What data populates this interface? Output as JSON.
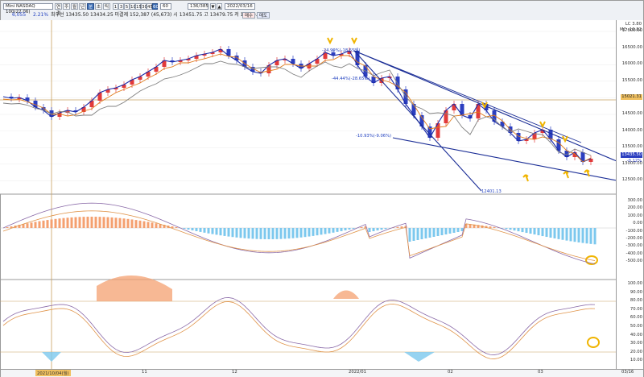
{
  "toolbar": {
    "symbol": "Mini NASDAQ 100(22.06)",
    "tab_labels": [
      "연결",
      "주",
      "월",
      "년",
      "분",
      "초",
      "틱"
    ],
    "interval_buttons": [
      "1",
      "3",
      "5",
      "10",
      "15",
      "30",
      "45",
      "60"
    ],
    "interval_input": "60",
    "count_input": "136/385",
    "date_input": "2022/03/16",
    "row1_extra": [
      "▼",
      "▲"
    ],
    "change_value": "6,055",
    "change_pct": "2.21%",
    "price_line": "최우선 13435.50  13434.25 미결제  152,387 (45,673) 시 13451.75 고 13479.75 저 13420.50",
    "order_button": "매수",
    "sell_button": "매도"
  },
  "price_axis": {
    "labels": [
      "17000.00",
      "16500.00",
      "16000.00",
      "15500.00",
      "15000.00",
      "14500.00",
      "14000.00",
      "13500.00",
      "13000.00",
      "12500.00"
    ],
    "top_labels": [
      "LC 3.80",
      "MC -10.82"
    ],
    "hline_tag": "15021.31",
    "last_price_tag": "13435.50",
    "last_change_tag": "-0.12%"
  },
  "macd_axis": {
    "labels": [
      "300.00",
      "200.00",
      "100.00",
      "0.00",
      "-100.00",
      "-200.00",
      "-300.00",
      "-400.00",
      "-500.00"
    ]
  },
  "stoch_axis": {
    "labels": [
      "100.00",
      "90.00",
      "80.00",
      "70.00",
      "60.00",
      "50.00",
      "40.00",
      "30.00",
      "20.00",
      "10.00"
    ]
  },
  "x_axis": {
    "cursor_date": "2021/10/04(월)",
    "labels": [
      "11",
      "12",
      "2022/01",
      "02",
      "03",
      "03/16"
    ]
  },
  "annotations": {
    "high_label": "-24.99%(-18.55%)",
    "mid_label": "-44.44%(-28.65%)",
    "low_channel_label": "-10.93%(-9.06%)",
    "bottom_label": "12401.13"
  },
  "colors": {
    "up": "#e23a3a",
    "down": "#2c3fc0",
    "ma_fast": "#1a2aa8",
    "ma_mid": "#e07a1a",
    "ma_slow": "#808080",
    "trendline": "#1a2d96",
    "histogram_pos": "#f4a070",
    "histogram_neg": "#7cc8ee",
    "highlight": "#f0b400"
  }
}
